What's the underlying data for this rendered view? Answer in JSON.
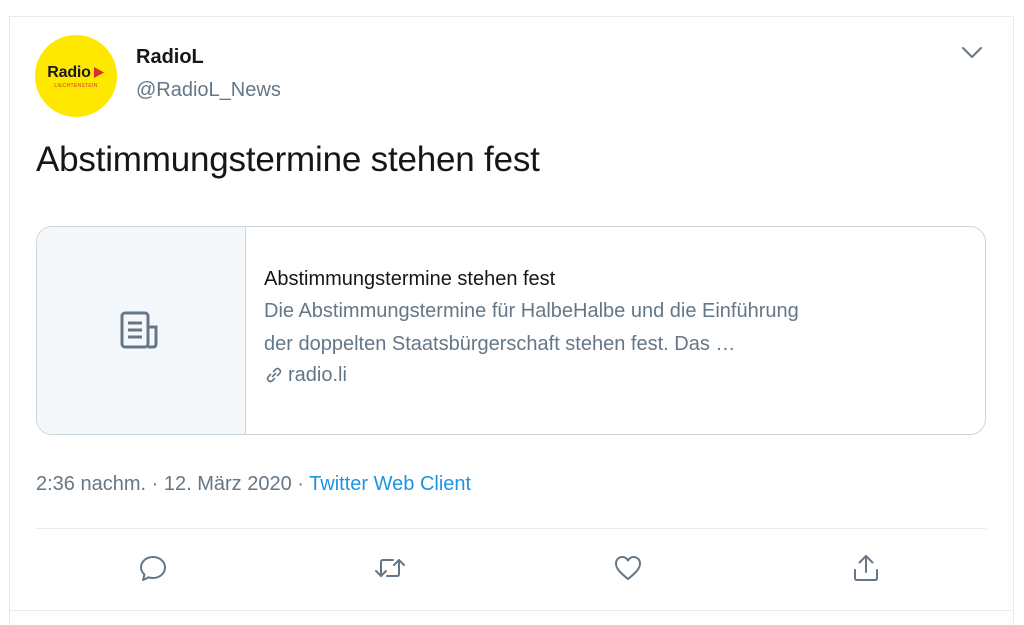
{
  "account": {
    "name": "RadioL",
    "handle": "@RadioL_News",
    "avatar_logo_text": "Radio",
    "avatar_logo_subtext": "LIECHTENSTEIN",
    "avatar_bg": "#ffe800"
  },
  "tweet": {
    "text": "Abstimmungstermine stehen fest"
  },
  "card": {
    "title": "Abstimmungstermine stehen fest",
    "description_line1": "Die Abstimmungstermine für HalbeHalbe und die Einführung",
    "description_line2": "der doppelten Staatsbürgerschaft stehen fest. Das …",
    "domain": "radio.li",
    "thumb_icon": "article-icon"
  },
  "meta": {
    "time": "2:36 nachm.",
    "separator": "·",
    "date": "12. März 2020",
    "client": "Twitter Web Client"
  },
  "actions": [
    "reply-icon",
    "retweet-icon",
    "like-icon",
    "share-icon"
  ],
  "colors": {
    "link": "#1b95e0",
    "secondary_text": "#657786",
    "primary_text": "#14171a",
    "border": "#ccd6dd"
  }
}
